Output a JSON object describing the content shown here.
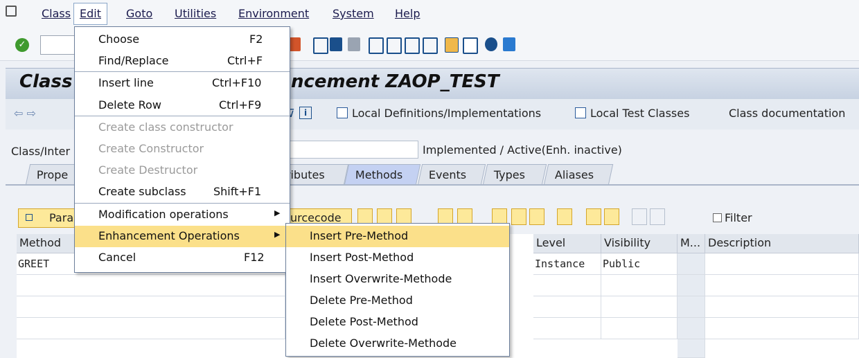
{
  "menubar": {
    "items": [
      "Class",
      "Edit",
      "Goto",
      "Utilities",
      "Environment",
      "System",
      "Help"
    ]
  },
  "title": {
    "left": "Class",
    "right": "ncement ZAOP_TEST"
  },
  "app_toolbar": {
    "local_defs": "Local Definitions/Implementations",
    "local_tests": "Local Test Classes",
    "class_doc": "Class documentation"
  },
  "class_field": {
    "label": "Class/Inter",
    "status": "Implemented / Active(Enh. inactive)"
  },
  "tabs": [
    "Prope",
    "ributes",
    "Methods",
    "Events",
    "Types",
    "Aliases"
  ],
  "grid_toolbar": {
    "param_label": "Para",
    "source_label": "urcecode",
    "filter_label": "Filter"
  },
  "grid": {
    "headers": [
      "Method",
      "Level",
      "Visibility",
      "M...",
      "Description"
    ],
    "rows": [
      {
        "method": "GREET",
        "level": "Instance",
        "visibility": "Public"
      }
    ]
  },
  "edit_menu": {
    "items": [
      {
        "label": "Choose",
        "accel": "F2"
      },
      {
        "label": "Find/Replace",
        "accel": "Ctrl+F"
      },
      {
        "label": "Insert line",
        "accel": "Ctrl+F10"
      },
      {
        "label": "Delete Row",
        "accel": "Ctrl+F9"
      },
      {
        "label": "Create class constructor",
        "accel": ""
      },
      {
        "label": "Create Constructor",
        "accel": ""
      },
      {
        "label": "Create Destructor",
        "accel": ""
      },
      {
        "label": "Create subclass",
        "accel": "Shift+F1"
      },
      {
        "label": "Modification operations",
        "accel": ""
      },
      {
        "label": "Enhancement Operations",
        "accel": ""
      },
      {
        "label": "Cancel",
        "accel": "F12"
      }
    ]
  },
  "submenu": {
    "items": [
      "Insert Pre-Method",
      "Insert Post-Method",
      "Insert Overwrite-Methode",
      "Delete Pre-Method",
      "Delete Post-Method",
      "Delete Overwrite-Methode"
    ]
  },
  "icons": [
    "system-menu-icon",
    "ok-check-icon",
    "print-icon",
    "find-icon",
    "find-next-icon",
    "first-page-icon",
    "previous-page-icon",
    "next-page-icon",
    "last-page-icon",
    "help-icon",
    "customize-layout-icon",
    "back-arrow-icon",
    "forward-arrow-icon",
    "info-icon",
    "filter-icon",
    "cut-icon",
    "copy-icon",
    "paste-icon",
    "undo-icon"
  ],
  "colors": {
    "highlight": "#fbe08a",
    "tab_active": "#c4d1f2",
    "button": "#fde99a",
    "ok_green": "#3f9a2e"
  }
}
